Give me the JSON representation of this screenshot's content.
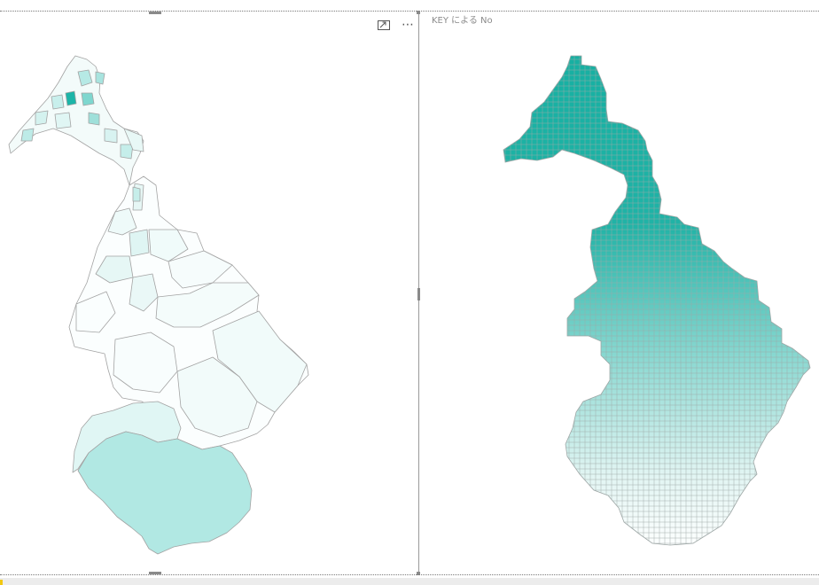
{
  "left_visual": {
    "title": "",
    "icons": {
      "focus": "focus-mode-icon",
      "more": "more-options-icon"
    },
    "fill_color_high": "#00b3a4",
    "fill_color_low": "#ffffff",
    "border_color": "#a3a3a3"
  },
  "right_visual": {
    "title": "KEY による No",
    "fill_color_top": "#16b0a2",
    "fill_color_bottom": "#ffffff",
    "grid_color": "#9ea7a6"
  },
  "accent_colors": {
    "selection": "#8a8a8a",
    "status_tick": "#f2c811"
  }
}
